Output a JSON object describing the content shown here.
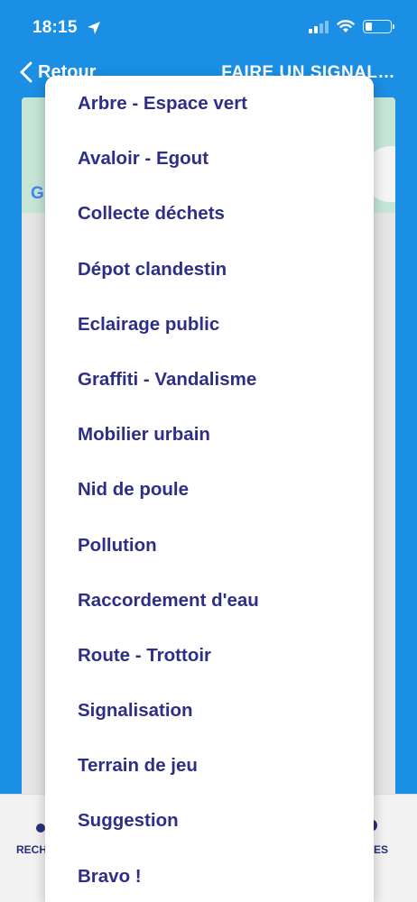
{
  "status": {
    "time": "18:15"
  },
  "nav": {
    "back_label": "Retour",
    "title": "FAIRE UN SIGNAL…"
  },
  "map": {
    "google_letter": "G"
  },
  "tabbar": {
    "left_label": "RECH",
    "right_label": "ES"
  },
  "dropdown": {
    "items": [
      "Arbre - Espace vert",
      "Avaloir - Egout",
      "Collecte déchets",
      "Dépot clandestin",
      "Eclairage public",
      "Graffiti - Vandalisme",
      "Mobilier urbain",
      "Nid de poule",
      "Pollution",
      "Raccordement d'eau",
      "Route - Trottoir",
      "Signalisation",
      "Terrain de jeu",
      "Suggestion",
      "Bravo !"
    ]
  },
  "colors": {
    "header_blue": "#1a8fe3",
    "item_text": "#2d2f86",
    "map_green": "#c5e5d5"
  }
}
